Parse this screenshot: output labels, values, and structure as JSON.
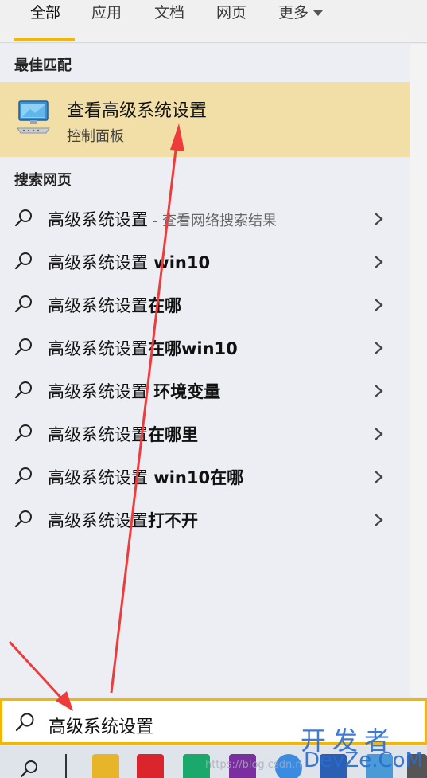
{
  "tabs": [
    {
      "label": "全部",
      "active": true
    },
    {
      "label": "应用"
    },
    {
      "label": "文档"
    },
    {
      "label": "网页"
    },
    {
      "label": "更多"
    }
  ],
  "best_match": {
    "section_title": "最佳匹配",
    "title": "查看高级系统设置",
    "subtitle": "控制面板",
    "icon": "control-panel-monitor-icon"
  },
  "web_search": {
    "section_title": "搜索网页",
    "items": [
      {
        "prefix": "高级系统设置",
        "suffix": " - 查看网络搜索结果",
        "suffix_style": "light"
      },
      {
        "prefix": "高级系统设置",
        "suffix": " win10",
        "suffix_style": "bold"
      },
      {
        "prefix": "高级系统设置",
        "suffix": "在哪",
        "suffix_style": "bold"
      },
      {
        "prefix": "高级系统设置",
        "suffix": "在哪win10",
        "suffix_style": "bold"
      },
      {
        "prefix": "高级系统设置",
        "suffix": " 环境变量",
        "suffix_style": "bold"
      },
      {
        "prefix": "高级系统设置",
        "suffix": "在哪里",
        "suffix_style": "bold"
      },
      {
        "prefix": "高级系统设置",
        "suffix": " win10在哪",
        "suffix_style": "bold"
      },
      {
        "prefix": "高级系统设置",
        "suffix": "打不开",
        "suffix_style": "bold"
      }
    ]
  },
  "search_box": {
    "value": "高级系统设置",
    "icon": "search-icon"
  },
  "watermark": {
    "line1": "开发者",
    "line2": "DevZe.CoM",
    "url": "https://blog.csdn.n"
  },
  "colors": {
    "accent": "#f2b705",
    "highlight": "#f1dfa7",
    "arrow": "#ee3b3b"
  }
}
